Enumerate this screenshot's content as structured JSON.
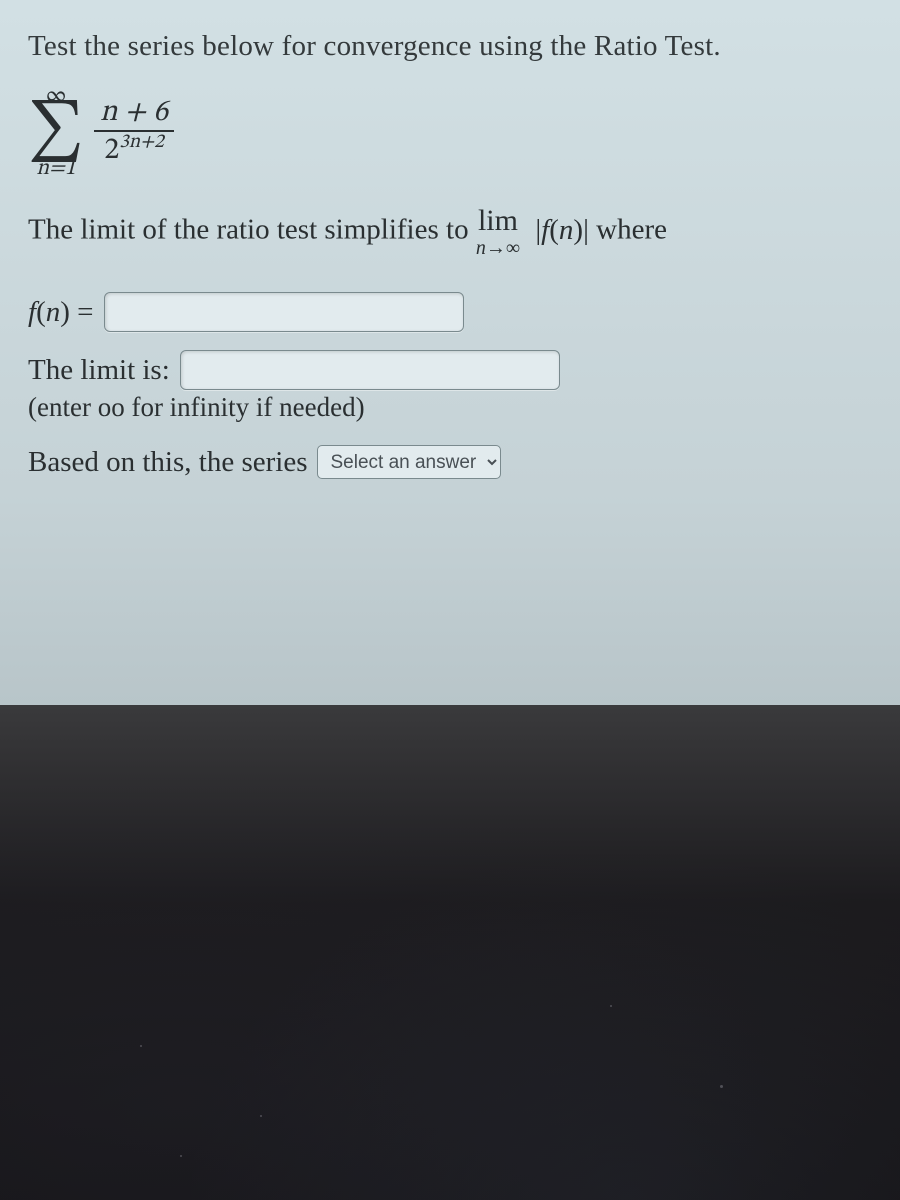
{
  "instruction": "Test the series below for convergence using the Ratio Test.",
  "series": {
    "upper": "∞",
    "lower": "n=1",
    "numerator": "n + 6",
    "denom_base": "2",
    "denom_exp": "3n+2"
  },
  "explain": {
    "prefix": "The limit of the ratio test simplifies to ",
    "lim": "lim",
    "limsub_var": "n",
    "limsub_arrow": "→",
    "limsub_inf": "∞",
    "abs_open": "|",
    "fn_f": "f",
    "fn_open": "(",
    "fn_var": "n",
    "fn_close": ")",
    "abs_close": "|",
    "suffix": " where"
  },
  "fn_row": {
    "f": "f",
    "open": "(",
    "var": "n",
    "close": ")",
    "eq": " = ",
    "placeholder": ""
  },
  "limit_row": {
    "label": "The limit is:",
    "placeholder": ""
  },
  "hint": "(enter oo for infinity if needed)",
  "based_row": {
    "label": "Based on this, the series",
    "select_placeholder": "Select an answer"
  }
}
